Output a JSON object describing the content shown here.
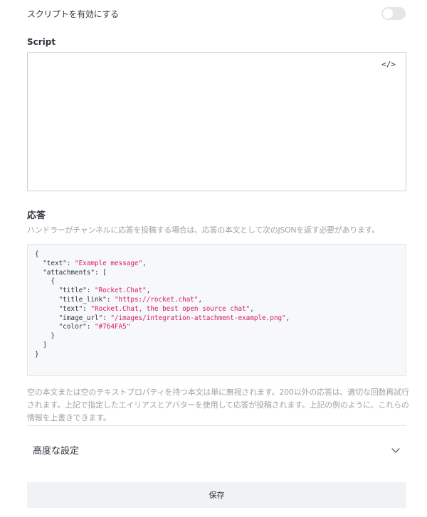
{
  "script_toggle": {
    "label": "スクリプトを有効にする",
    "enabled": false
  },
  "script": {
    "label": "Script",
    "code_icon": "</>"
  },
  "response": {
    "title": "応答",
    "description": "ハンドラーがチャンネルに応答を投稿する場合は、応答の本文として次のJSONを返す必要があります。",
    "json_lines": [
      {
        "text": "{"
      },
      {
        "text": "  \"text\": ",
        "str": "\"Example message\"",
        "suffix": ","
      },
      {
        "text": "  \"attachments\": ["
      },
      {
        "text": "    {"
      },
      {
        "text": "      \"title\": ",
        "str": "\"Rocket.Chat\"",
        "suffix": ","
      },
      {
        "text": "      \"title_link\": ",
        "str": "\"https://rocket.chat\"",
        "suffix": ","
      },
      {
        "text": "      \"text\": ",
        "str": "\"Rocket.Chat, the best open source chat\"",
        "suffix": ","
      },
      {
        "text": "      \"image_url\": ",
        "str": "\"/images/integration-attachment-example.png\"",
        "suffix": ","
      },
      {
        "text": "      \"color\": ",
        "str": "\"#764FA5\""
      },
      {
        "text": "    }"
      },
      {
        "text": "  ]"
      },
      {
        "text": "}"
      }
    ],
    "footnote": "空の本文または空のテキストプロパティを持つ本文は単に無視されます。200以外の応答は、適切な回数再試行されます。上記で指定したエイリアスとアバターを使用して応答が投稿されます。上記の例のように、これらの情報を上書きできます。"
  },
  "advanced": {
    "label": "高度な設定"
  },
  "save": {
    "label": "保存"
  }
}
